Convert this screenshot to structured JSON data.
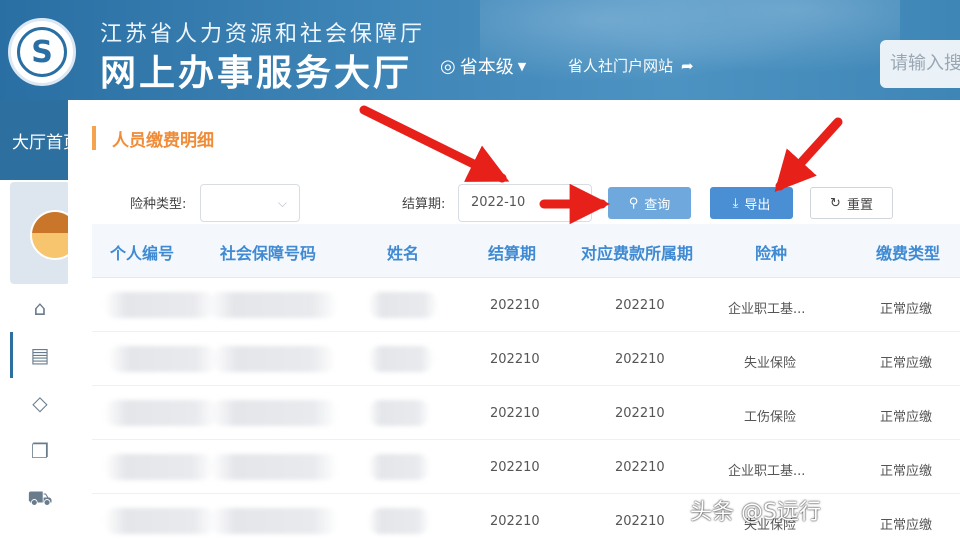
{
  "header": {
    "org_name": "江苏省人力资源和社会保障厅",
    "hall_name": "网上办事服务大厅",
    "logo_letter": "S",
    "level_label": "省本级",
    "portal_link": "省人社门户网站",
    "search_placeholder": "请输入搜"
  },
  "nav": {
    "first_item": "大厅首页"
  },
  "dialog": {
    "title": "人员缴费明细",
    "filters": {
      "insurance_type_label": "险种类型:",
      "insurance_type_value": "",
      "settle_period_label": "结算期:",
      "settle_period_value": "2022-10"
    },
    "buttons": {
      "query": "查询",
      "export": "导出",
      "reset": "重置"
    },
    "table": {
      "columns": [
        "个人编号",
        "社会保障号码",
        "姓名",
        "结算期",
        "对应费款所属期",
        "险种",
        "缴费类型"
      ],
      "rows": [
        {
          "period": "202210",
          "fee_period": "202210",
          "insurance": "企业职工基...",
          "pay_type": "正常应缴"
        },
        {
          "period": "202210",
          "fee_period": "202210",
          "insurance": "失业保险",
          "pay_type": "正常应缴"
        },
        {
          "period": "202210",
          "fee_period": "202210",
          "insurance": "工伤保险",
          "pay_type": "正常应缴"
        },
        {
          "period": "202210",
          "fee_period": "202210",
          "insurance": "企业职工基...",
          "pay_type": "正常应缴"
        },
        {
          "period": "202210",
          "fee_period": "202210",
          "insurance": "失业保险",
          "pay_type": "正常应缴"
        }
      ]
    }
  },
  "watermark": {
    "text": "头条 @S远行"
  },
  "colors": {
    "header_blue": "#2a6fa3",
    "title_orange": "#f08c38",
    "column_blue": "#3f8ad2",
    "arrow_red": "#e8201a"
  }
}
